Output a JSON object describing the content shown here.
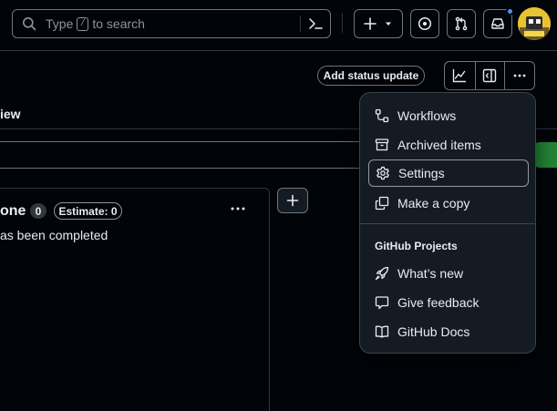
{
  "header": {
    "search": {
      "prefix": "Type",
      "key": "/",
      "suffix": "to search"
    }
  },
  "toolbar": {
    "status_button": "Add status update"
  },
  "view_tab": {
    "label": "iew"
  },
  "column": {
    "title": "one",
    "count": "0",
    "estimate": "Estimate: 0",
    "description": "as been completed"
  },
  "menu": {
    "items": [
      {
        "label": "Workflows",
        "icon": "workflow-icon"
      },
      {
        "label": "Archived items",
        "icon": "archive-icon"
      },
      {
        "label": "Settings",
        "icon": "gear-icon"
      },
      {
        "label": "Make a copy",
        "icon": "copy-icon"
      }
    ],
    "group_title": "GitHub Projects",
    "group_items": [
      {
        "label": "What’s new",
        "icon": "rocket-icon"
      },
      {
        "label": "Give feedback",
        "icon": "comment-icon"
      },
      {
        "label": "GitHub Docs",
        "icon": "book-icon"
      }
    ]
  },
  "colors": {
    "background": "#010409",
    "menu_bg": "#151b23",
    "border": "#30363d",
    "text": "#e6edf3",
    "muted": "#8b949e",
    "accent_green": "#238636",
    "notification_blue": "#4493f8"
  }
}
